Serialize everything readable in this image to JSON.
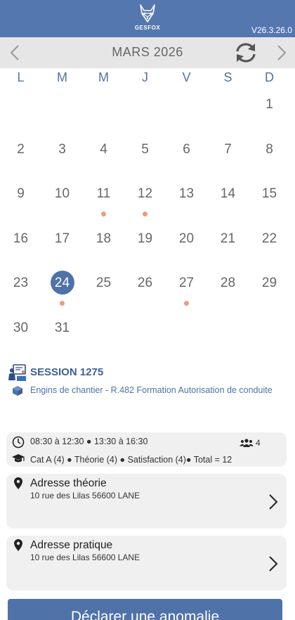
{
  "app": {
    "logo_text": "GESFOX",
    "version": "V26.3.26.0"
  },
  "calendar": {
    "month_title": "MARS 2026",
    "weekdays": [
      "L",
      "M",
      "M",
      "J",
      "V",
      "S",
      "D"
    ],
    "selected_day": 24,
    "event_days": [
      11,
      12,
      24,
      27
    ]
  },
  "session": {
    "title": "SESSION 1275",
    "course": "Engins de chantier - R.482 Formation Autorisation de conduite"
  },
  "schedule": {
    "times": "08:30 à 12:30 ● 13:30 à 16:30",
    "participants": "4",
    "categories": "Cat A (4) ● Théorie (4) ● Satisfaction (4)● Total = 12"
  },
  "theory_address": {
    "title": "Adresse théorie",
    "address": "10 rue des Lilas 56600 LANE"
  },
  "practice_address": {
    "title": "Adresse pratique",
    "address": "10 rue des Lilas 56600 LANE"
  },
  "actions": {
    "declare_label": "Déclarer une anomalie"
  },
  "colors": {
    "header": "#5577b0",
    "accent": "#4f72a8",
    "event_dot": "#ef9a7c",
    "card": "#f0f0f0"
  },
  "icons": [
    "fox-logo-icon",
    "chevron-left-icon",
    "sync-icon",
    "chevron-right-icon",
    "session-board-icon",
    "cube-icon",
    "clock-icon",
    "group-icon",
    "graduation-cap-icon",
    "location-pin-icon"
  ]
}
